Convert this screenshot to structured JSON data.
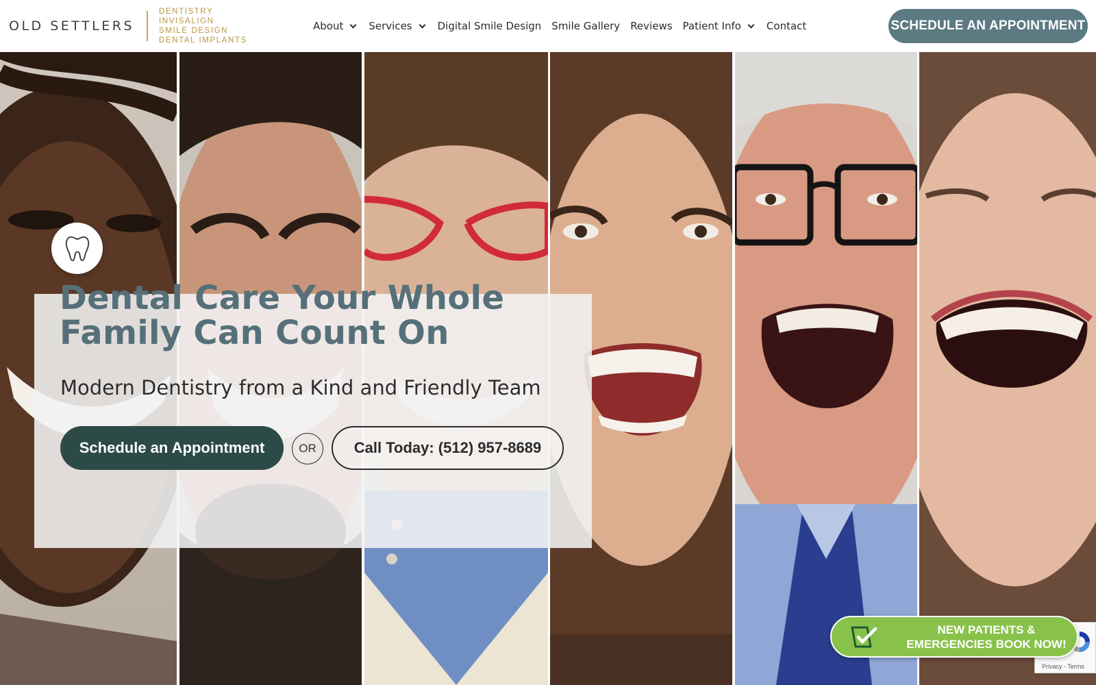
{
  "brand": {
    "name": "OLD SETTLERS",
    "services": [
      "DENTISTRY",
      "INVISALIGN",
      "SMILE DESIGN",
      "DENTAL IMPLANTS"
    ],
    "accent_color": "#c7a24d"
  },
  "nav": {
    "items": [
      {
        "label": "About",
        "dropdown": true
      },
      {
        "label": "Services",
        "dropdown": true
      },
      {
        "label": "Digital Smile Design",
        "dropdown": false
      },
      {
        "label": "Smile Gallery",
        "dropdown": false
      },
      {
        "label": "Reviews",
        "dropdown": false
      },
      {
        "label": "Patient Info",
        "dropdown": true
      },
      {
        "label": "Contact",
        "dropdown": false
      }
    ],
    "cta_label": "SCHEDULE AN APPOINTMENT",
    "cta_color": "#5c7a82"
  },
  "hero": {
    "badge_icon": "tooth-icon",
    "headline_line1": "Dental Care Your Whole",
    "headline_line2": "Family Can Count On",
    "subheadline": "Modern Dentistry from a Kind and Friendly Team",
    "primary_button": "Schedule an Appointment",
    "or_label": "OR",
    "secondary_button": "Call Today: (512) 957-8689",
    "primary_color": "#2c4a46",
    "headline_color": "#567079"
  },
  "floating_badge": {
    "icon": "calendar-check-icon",
    "line1": "NEW PATIENTS &",
    "line2": "EMERGENCIES BOOK NOW!",
    "color": "#88c24a"
  },
  "recaptcha": {
    "icon": "recaptcha-icon",
    "privacy": "Privacy",
    "separator": " - ",
    "terms": "Terms"
  }
}
